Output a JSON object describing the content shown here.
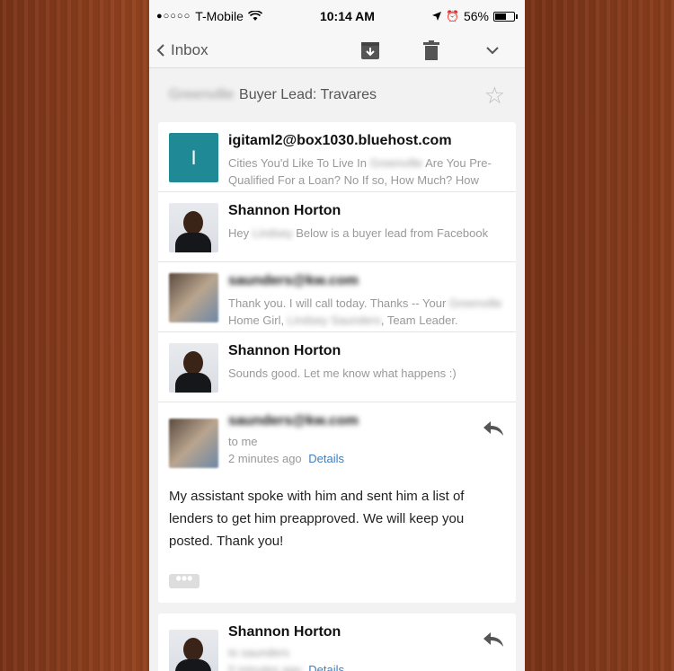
{
  "status": {
    "carrier": "T-Mobile",
    "time": "10:14 AM",
    "battery": "56%"
  },
  "toolbar": {
    "back_label": "Inbox",
    "icons": [
      "chevron-left-icon",
      "archive-icon",
      "trash-icon",
      "chevron-down-icon"
    ]
  },
  "subject": {
    "blurred_prefix": "Greenville",
    "title": "Buyer Lead: Travares"
  },
  "messages": [
    {
      "avatar_letter": "I",
      "sender": "igitaml2@box1030.bluehost.com",
      "snippet_a": "Cities You'd Like To Live In",
      "snippet_blur": "Greenville",
      "snippet_b": "Are You Pre-Qualified For a Loan? No If so, How Much? How"
    },
    {
      "sender": "Shannon Horton",
      "snippet_a": "Hey",
      "snippet_blur": "Lindsey",
      "snippet_b": "Below is a buyer lead from Facebook"
    },
    {
      "sender_blur": "saunders@kw.com",
      "snippet_a": "Thank you. I will call today. Thanks -- Your",
      "snippet_blur": "Greenville",
      "snippet_b": "Home Girl,",
      "snippet_blur2": "Lindsey Saunders",
      "snippet_c": ", Team Leader."
    },
    {
      "sender": "Shannon Horton",
      "snippet_a": "Sounds good. Let me know what happens :)"
    }
  ],
  "expanded": {
    "sender_blur": "saunders@kw.com",
    "to": "to me",
    "time": "2 minutes ago",
    "details": "Details",
    "body": "My assistant spoke with him and sent him a list of lenders to get him preapproved. We will keep you posted. Thank you!",
    "more": "•••"
  },
  "next": {
    "sender": "Shannon Horton",
    "to_blur": "to saunders",
    "time_blur": "0 minutes ago",
    "details": "Details"
  }
}
